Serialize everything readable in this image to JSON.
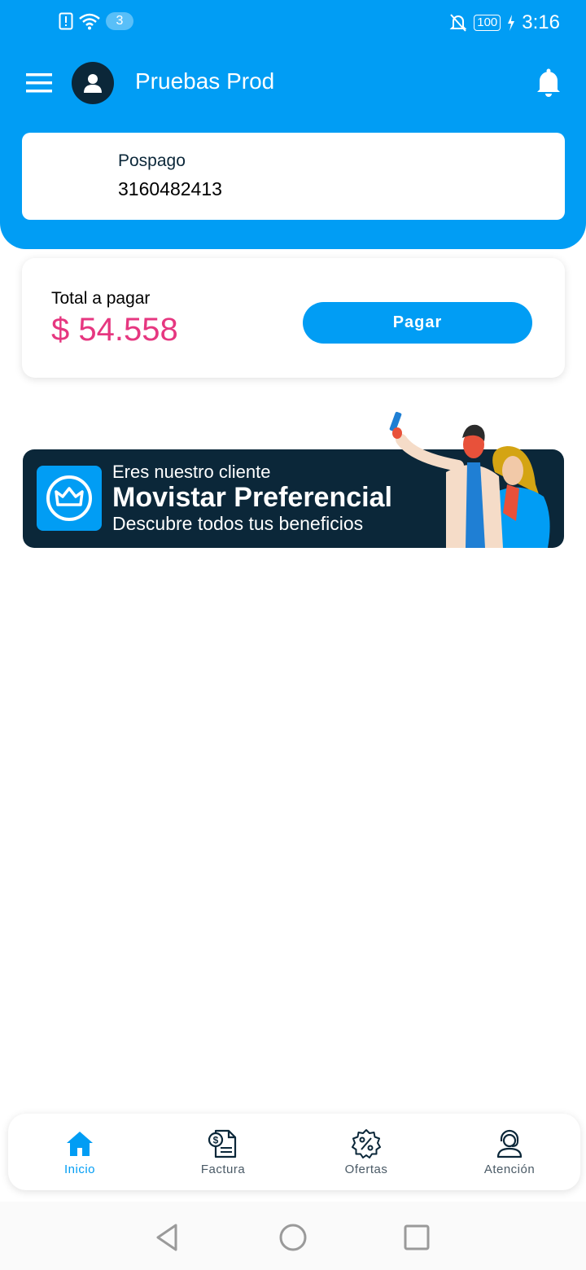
{
  "status_bar": {
    "notification_count": "3",
    "battery": "100",
    "time": "3:16"
  },
  "header": {
    "user_name": "Pruebas Prod",
    "line_type": "Pospago",
    "line_number": "3160482413"
  },
  "payment": {
    "total_label": "Total a pagar",
    "total_amount": "$ 54.558",
    "pay_button": "Pagar"
  },
  "banner": {
    "line1": "Eres nuestro cliente",
    "line2": "Movistar Preferencial",
    "line3": "Descubre todos tus beneficios"
  },
  "bottom_nav": {
    "items": [
      {
        "label": "Inicio",
        "icon": "home-icon",
        "active": true
      },
      {
        "label": "Factura",
        "icon": "invoice-icon",
        "active": false
      },
      {
        "label": "Ofertas",
        "icon": "offers-icon",
        "active": false
      },
      {
        "label": "Atención",
        "icon": "support-icon",
        "active": false
      }
    ]
  },
  "colors": {
    "brand_blue": "#019df4",
    "dark_navy": "#0b2739",
    "amount_pink": "#e63780"
  }
}
